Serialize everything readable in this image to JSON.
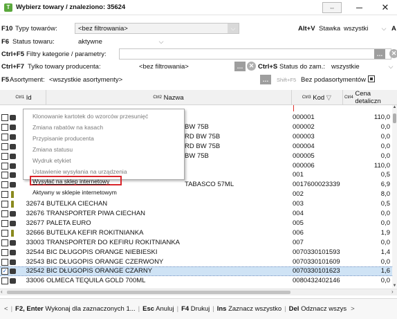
{
  "window": {
    "title": "Wybierz towary / znaleziono: 35624",
    "minimize": "—",
    "maximize": "☐",
    "close": "✕"
  },
  "filters": {
    "types": {
      "key": "F10",
      "label": "Typy towarów:",
      "value": "<bez filtrowania>"
    },
    "price": {
      "key": "Alt+V",
      "label": "Stawka:",
      "value": "wszystki",
      "trailing": "A"
    },
    "status": {
      "key": "F6",
      "label": "Status towaru:",
      "value": "aktywne"
    },
    "category": {
      "key": "Ctrl+F5",
      "label": "Filtry kategorie / parametry:",
      "value": ""
    },
    "producer": {
      "key": "Ctrl+F7",
      "label": "Tylko towary producenta:",
      "value": "<bez filtrowania>"
    },
    "order_status": {
      "key": "Ctrl+S",
      "label": "Status do zam.:",
      "value": "wszystkie"
    },
    "assortment": {
      "key": "F5",
      "label": "Asortyment:",
      "value": "<wszystkie asortymenty>"
    },
    "no_subassortment": {
      "key": "Shift+F5",
      "label": "Bez podasortymentów",
      "checked": true
    }
  },
  "grid": {
    "columns": [
      {
        "ctrl": "Ctrl",
        "num": "1",
        "label": "Id"
      },
      {
        "ctrl": "Ctrl",
        "num": "2",
        "label": "Nazwa"
      },
      {
        "ctrl": "Ctrl",
        "num": "3",
        "label": "Kod",
        "sort": "▽"
      },
      {
        "ctrl": "Ctrl",
        "num": "4",
        "label": "Cena detaliczn"
      }
    ],
    "rows": [
      {
        "id": "",
        "name": "",
        "name_tail": "",
        "code": "000001",
        "price": "110,0",
        "icon": "box",
        "checked": false
      },
      {
        "id": "",
        "name": "",
        "name_tail": "BW 75B",
        "code": "000002",
        "price": "0,0",
        "icon": "box",
        "checked": false
      },
      {
        "id": "",
        "name": "",
        "name_tail": "RD BW 75B",
        "code": "000003",
        "price": "0,0",
        "icon": "box",
        "checked": false
      },
      {
        "id": "",
        "name": "",
        "name_tail": "RD BW 75B",
        "code": "000004",
        "price": "0,0",
        "icon": "box",
        "checked": false
      },
      {
        "id": "",
        "name": "",
        "name_tail": "BW 75B",
        "code": "000005",
        "price": "0,0",
        "icon": "box",
        "checked": false
      },
      {
        "id": "",
        "name": "",
        "name_tail": "",
        "code": "000006",
        "price": "110,0",
        "icon": "box",
        "checked": false
      },
      {
        "id": "",
        "name": "",
        "name_tail": "",
        "code": "001",
        "price": "0,5",
        "icon": "box",
        "checked": false
      },
      {
        "id": "",
        "name": "",
        "name_tail": "TABASCO 57ML",
        "code": "0017600023339",
        "price": "6,9",
        "icon": "box",
        "checked": false
      },
      {
        "id": "",
        "name": "",
        "name_tail": "",
        "code": "002",
        "price": "8,0",
        "icon": "bottle",
        "checked": false
      },
      {
        "id": "32674",
        "name": "BUTELKA CIECHAN",
        "name_tail": "",
        "code": "003",
        "price": "0,5",
        "icon": "bottle",
        "checked": false
      },
      {
        "id": "32676",
        "name": "TRANSPORTER PIWA CIECHAN",
        "name_tail": "",
        "code": "004",
        "price": "0,0",
        "icon": "box",
        "checked": false
      },
      {
        "id": "32677",
        "name": "PALETA EURO",
        "name_tail": "",
        "code": "005",
        "price": "0,0",
        "icon": "box",
        "checked": false
      },
      {
        "id": "32666",
        "name": "BUTELKA KEFIR ROKITNIANKA",
        "name_tail": "",
        "code": "006",
        "price": "1,9",
        "icon": "bottle",
        "checked": false
      },
      {
        "id": "33003",
        "name": "TRANSPORTER DO KEFIRU ROKITNIANKA",
        "name_tail": "",
        "code": "007",
        "price": "0,0",
        "icon": "box",
        "checked": false
      },
      {
        "id": "32544",
        "name": "BIC DŁUGOPIS ORANGE NIEBIESKI",
        "name_tail": "",
        "code": "0070330101593",
        "price": "1,4",
        "icon": "box",
        "checked": false
      },
      {
        "id": "32543",
        "name": "BIC DŁUGOPIS ORANGE CZERWONY",
        "name_tail": "",
        "code": "0070330101609",
        "price": "0,0",
        "icon": "box",
        "checked": false
      },
      {
        "id": "32542",
        "name": "BIC DŁUGOPIS ORANGE CZARNY",
        "name_tail": "",
        "code": "0070330101623",
        "price": "1,6",
        "icon": "box",
        "checked": true,
        "selected": true
      },
      {
        "id": "33006",
        "name": "OLMECA TEQUILA GOLD 700ML",
        "name_tail": "",
        "code": "0080432402146",
        "price": "0,0",
        "icon": "box",
        "checked": false
      }
    ]
  },
  "context_menu": {
    "items": [
      {
        "label": "Klonowanie kartotek do wzorców przesunięć",
        "enabled": false
      },
      {
        "label": "Zmiana rabatów na kasach",
        "enabled": false
      },
      {
        "label": "Przypisanie producenta",
        "enabled": false
      },
      {
        "label": "Zmiana statusu",
        "enabled": false
      },
      {
        "label": "Wydruk etykiet",
        "enabled": false
      },
      {
        "label": "Ustawienie wysyłania na urządzenia",
        "enabled": false
      },
      {
        "label": "Wysyłać na sklep internetowy",
        "enabled": true,
        "highlighted": true
      },
      {
        "label": "Aktywny w sklepie internetowym",
        "enabled": true
      }
    ]
  },
  "statusbar": {
    "items": [
      {
        "key": "F2, Enter",
        "label": "Wykonaj dla zaznaczonych 1..."
      },
      {
        "key": "Esc",
        "label": "Anuluj"
      },
      {
        "key": "F4",
        "label": "Drukuj"
      },
      {
        "key": "Ins",
        "label": "Zaznacz wszystko"
      },
      {
        "key": "Del",
        "label": "Odznacz wszys"
      }
    ]
  },
  "colors": {
    "accent": "#1a5cc0",
    "highlight_border": "#d8252b",
    "selection": "#cfe3f5"
  }
}
